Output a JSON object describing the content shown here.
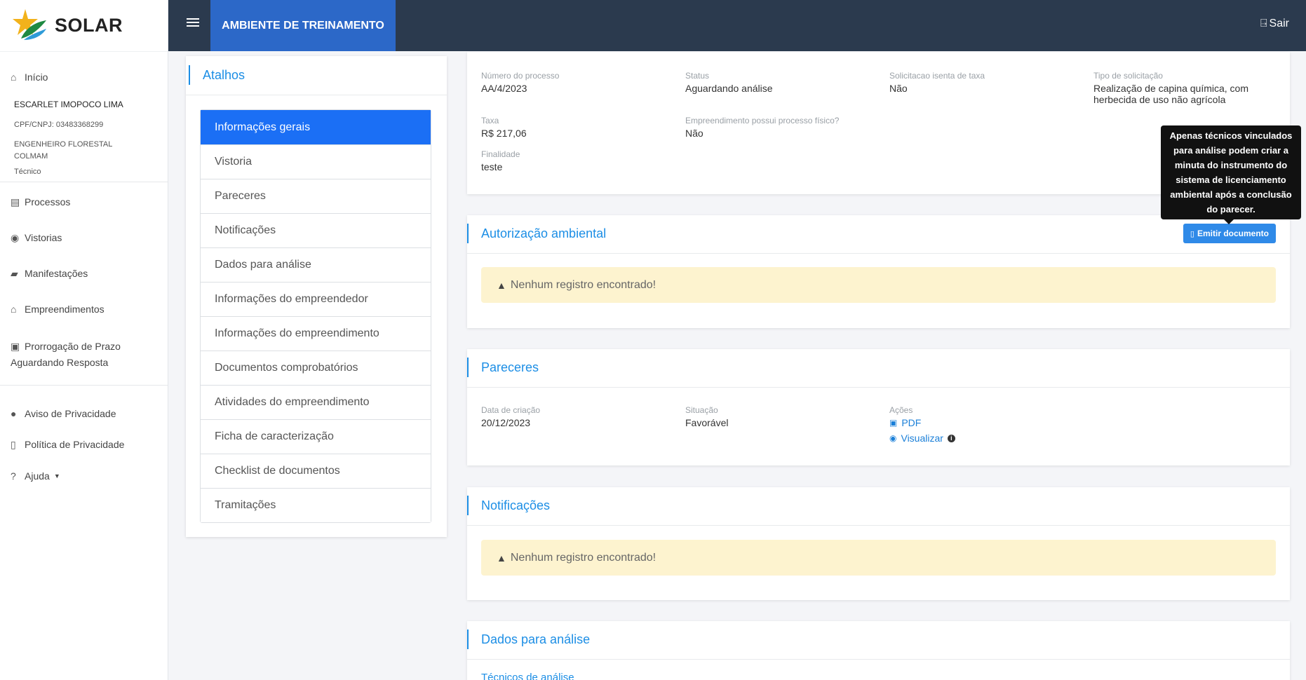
{
  "brand": {
    "name": "SOLAR"
  },
  "header": {
    "environment": "AMBIENTE DE TREINAMENTO",
    "logout_label": "Sair"
  },
  "sidebar": {
    "home": "Início",
    "user": {
      "name": "ESCARLET IMOPOCO LIMA",
      "document": "CPF/CNPJ: 03483368299",
      "role_line1": "ENGENHEIRO FLORESTAL",
      "role_line2": "COLMAM",
      "profile": "Técnico"
    },
    "items": [
      {
        "label": "Processos"
      },
      {
        "label": "Vistorias"
      },
      {
        "label": "Manifestações"
      },
      {
        "label": "Empreendimentos"
      },
      {
        "label": "Prorrogação de Prazo Aguardando Resposta"
      }
    ],
    "footer_items": [
      {
        "label": "Aviso de Privacidade"
      },
      {
        "label": "Política de Privacidade"
      },
      {
        "label": "Ajuda"
      }
    ]
  },
  "shortcuts": {
    "title": "Atalhos",
    "items": [
      "Informações gerais",
      "Vistoria",
      "Pareceres",
      "Notificações",
      "Dados para análise",
      "Informações do empreendedor",
      "Informações do empreendimento",
      "Documentos comprobatórios",
      "Atividades do empreendimento",
      "Ficha de caracterização",
      "Checklist de documentos",
      "Tramitações"
    ]
  },
  "process": {
    "number_label": "Número do processo",
    "number": "AA/4/2023",
    "status_label": "Status",
    "status": "Aguardando análise",
    "exempt_label": "Solicitacao isenta de taxa",
    "exempt": "Não",
    "type_label": "Tipo de solicitação",
    "type_line1": "Realização de capina química, com",
    "type_line2": "herbecida de uso não agrícola",
    "fee_label": "Taxa",
    "fee": "R$ 217,06",
    "physical_label": "Empreendimento possui processo físico?",
    "physical": "Não",
    "purpose_label": "Finalidade",
    "purpose": "teste"
  },
  "authorization": {
    "title": "Autorização ambiental",
    "emit_button": "Emitir documento",
    "empty": "Nenhum registro encontrado!",
    "tooltip": "Apenas técnicos vinculados para análise podem criar a minuta do instrumento do sistema de licenciamento ambiental após a conclusão do parecer."
  },
  "opinions": {
    "title": "Pareceres",
    "created_label": "Data de criação",
    "created": "20/12/2023",
    "situation_label": "Situação",
    "situation": "Favorável",
    "actions_label": "Ações",
    "pdf": "PDF",
    "view": "Visualizar"
  },
  "notifications": {
    "title": "Notificações",
    "empty": "Nenhum registro encontrado!"
  },
  "analysis": {
    "title": "Dados para análise",
    "sub": "Técnicos de análise"
  },
  "colors": {
    "header_bg": "#2b3a4e",
    "env_tag": "#2c68c8",
    "accent": "#1c8ee5",
    "active_shortcut": "#1b6ff5",
    "warning_bg": "#fdf3cf"
  }
}
